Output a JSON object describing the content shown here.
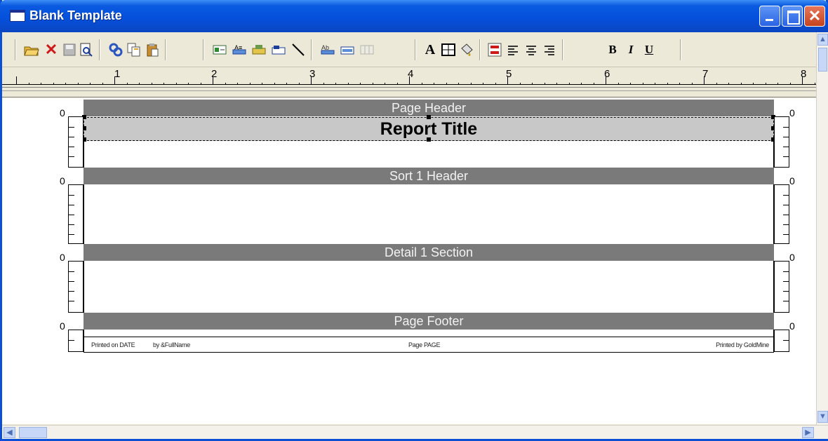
{
  "window": {
    "title": "Blank Template"
  },
  "toolbar": {
    "icons": [
      "open-folder-icon",
      "delete-icon",
      "save-icon",
      "print-preview-icon",
      "link-icon",
      "copy-icon",
      "paste-icon",
      "insert-field-icon",
      "insert-label-icon",
      "insert-image-icon",
      "insert-box-icon",
      "draw-line-icon",
      "align-left-icon",
      "align-top-icon",
      "grid-icon",
      "font-icon",
      "border-icon",
      "fill-icon",
      "color-icon",
      "text-left-icon",
      "text-center-icon",
      "text-right-icon",
      "bold-icon",
      "italic-icon",
      "underline-icon"
    ],
    "font_label": "A",
    "bold_label": "B",
    "italic_label": "I",
    "underline_label": "U"
  },
  "ruler": {
    "marks": [
      "1",
      "2",
      "3",
      "4",
      "5",
      "6",
      "7",
      "8"
    ]
  },
  "sections": {
    "page_header": "Page Header",
    "report_title": "Report Title",
    "sort_header": "Sort 1 Header",
    "detail": "Detail 1 Section",
    "page_footer": "Page Footer"
  },
  "zero_label": "0",
  "footer_fields": {
    "printed_on": "Printed on DATE",
    "by": "by &FullName",
    "page": "Page  PAGE",
    "printed_by": "Printed by GoldMine"
  }
}
